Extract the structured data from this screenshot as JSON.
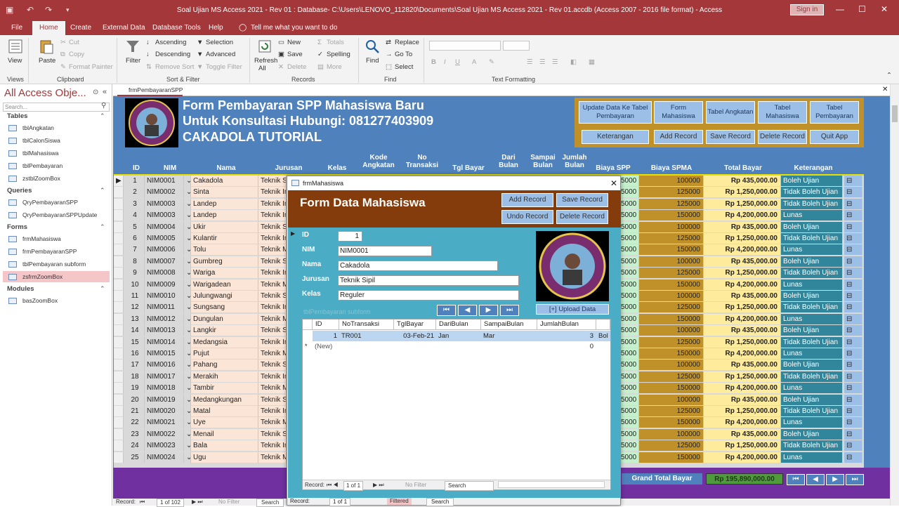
{
  "window": {
    "title": "Soal Ujian MS Access 2021 - Rev 01 : Database- C:\\Users\\LENOVO_112820\\Documents\\Soal Ujian MS Access 2021 - Rev 01.accdb (Access 2007 - 2016 file format) - Access",
    "sign_in": "Sign in"
  },
  "ribbon": {
    "tabs": [
      "File",
      "Home",
      "Create",
      "External Data",
      "Database Tools",
      "Help"
    ],
    "tell_me": "Tell me what you want to do",
    "views": {
      "view": "View",
      "group": "Views"
    },
    "clipboard": {
      "paste": "Paste",
      "cut": "Cut",
      "copy": "Copy",
      "format_painter": "Format Painter",
      "group": "Clipboard"
    },
    "sort_filter": {
      "filter": "Filter",
      "ascending": "Ascending",
      "descending": "Descending",
      "remove_sort": "Remove Sort",
      "selection": "Selection",
      "advanced": "Advanced",
      "toggle_filter": "Toggle Filter",
      "group": "Sort & Filter"
    },
    "records": {
      "refresh": "Refresh",
      "refresh_all": "All",
      "new": "New",
      "save": "Save",
      "delete": "Delete",
      "totals": "Totals",
      "spelling": "Spelling",
      "more": "More",
      "group": "Records"
    },
    "find": {
      "find": "Find",
      "replace": "Replace",
      "goto": "Go To",
      "select": "Select",
      "group": "Find"
    },
    "text_formatting": {
      "group": "Text Formatting"
    }
  },
  "nav": {
    "title": "All Access Obje...",
    "search_placeholder": "Search...",
    "sections": [
      {
        "name": "Tables",
        "items": [
          "tblAngkatan",
          "tblCalonSiswa",
          "tblMahasiswa",
          "tblPembayaran",
          "zstblZoomBox"
        ]
      },
      {
        "name": "Queries",
        "items": [
          "QryPembayaranSPP",
          "QryPembayaranSPPUpdate"
        ]
      },
      {
        "name": "Forms",
        "items": [
          "frmMahasiswa",
          "frmPembayaranSPP",
          "tblPembayaran subform",
          "zsfrmZoomBox"
        ]
      },
      {
        "name": "Modules",
        "items": [
          "basZoomBox"
        ]
      }
    ],
    "selected": "zsfrmZoomBox"
  },
  "document": {
    "tab": "frmPembayaranSPP",
    "header_lines": [
      "Form Pembayaran SPP Mahasiswa Baru",
      "Untuk Konsultasi Hubungi: 081277403909",
      "CAKADOLA TUTORIAL"
    ],
    "nav_buttons": [
      "Update Data Ke Tabel Pembayaran",
      "Form Mahasiswa",
      "Tabel Angkatan",
      "Tabel Mahasiswa",
      "Tabel Pembayaran"
    ],
    "action_buttons": [
      "Keterangan",
      "Add Record",
      "Save Record",
      "Delete Record",
      "Quit App"
    ],
    "columns": [
      "ID",
      "NIM",
      "Nama",
      "Jurusan",
      "Kelas",
      "Kode Angkatan",
      "No Transaksi",
      "Tgl Bayar",
      "Dari Bulan",
      "Sampai Bulan",
      "Jumlah Bulan",
      "Biaya SPP",
      "Biaya SPMA",
      "Total Bayar",
      "Keterangan"
    ],
    "rows": [
      {
        "id": "1",
        "nim": "NIM0001",
        "nama": "Cakadola",
        "jurusan": "Teknik S",
        "spp": "5000",
        "spma": "100000",
        "total": "Rp 435,000.00",
        "ket": "Boleh Ujian"
      },
      {
        "id": "2",
        "nim": "NIM0002",
        "nama": "Sinta",
        "jurusan": "Teknik In",
        "spp": "5000",
        "spma": "125000",
        "total": "Rp 1,250,000.00",
        "ket": "Tidak Boleh Ujian"
      },
      {
        "id": "3",
        "nim": "NIM0003",
        "nama": "Landep",
        "jurusan": "Teknik In",
        "spp": "5000",
        "spma": "125000",
        "total": "Rp 1,250,000.00",
        "ket": "Tidak Boleh Ujian"
      },
      {
        "id": "4",
        "nim": "NIM0003",
        "nama": "Landep",
        "jurusan": "Teknik In",
        "spp": "5000",
        "spma": "150000",
        "total": "Rp 4,200,000.00",
        "ket": "Lunas"
      },
      {
        "id": "5",
        "nim": "NIM0004",
        "nama": "Ukir",
        "jurusan": "Teknik S",
        "spp": "5000",
        "spma": "100000",
        "total": "Rp 435,000.00",
        "ket": "Boleh Ujian"
      },
      {
        "id": "6",
        "nim": "NIM0005",
        "nama": "Kulantir",
        "jurusan": "Teknik In",
        "spp": "5000",
        "spma": "125000",
        "total": "Rp 1,250,000.00",
        "ket": "Tidak Boleh Ujian"
      },
      {
        "id": "7",
        "nim": "NIM0006",
        "nama": "Tolu",
        "jurusan": "Teknik M",
        "spp": "5000",
        "spma": "150000",
        "total": "Rp 4,200,000.00",
        "ket": "Lunas"
      },
      {
        "id": "8",
        "nim": "NIM0007",
        "nama": "Gumbreg",
        "jurusan": "Teknik S",
        "spp": "5000",
        "spma": "100000",
        "total": "Rp 435,000.00",
        "ket": "Boleh Ujian"
      },
      {
        "id": "9",
        "nim": "NIM0008",
        "nama": "Wariga",
        "jurusan": "Teknik In",
        "spp": "5000",
        "spma": "125000",
        "total": "Rp 1,250,000.00",
        "ket": "Tidak Boleh Ujian"
      },
      {
        "id": "10",
        "nim": "NIM0009",
        "nama": "Warigadean",
        "jurusan": "Teknik M",
        "spp": "5000",
        "spma": "150000",
        "total": "Rp 4,200,000.00",
        "ket": "Lunas"
      },
      {
        "id": "11",
        "nim": "NIM0010",
        "nama": "Julungwangi",
        "jurusan": "Teknik S",
        "spp": "5000",
        "spma": "100000",
        "total": "Rp 435,000.00",
        "ket": "Boleh Ujian"
      },
      {
        "id": "12",
        "nim": "NIM0011",
        "nama": "Sungsang",
        "jurusan": "Teknik In",
        "spp": "5000",
        "spma": "125000",
        "total": "Rp 1,250,000.00",
        "ket": "Tidak Boleh Ujian"
      },
      {
        "id": "13",
        "nim": "NIM0012",
        "nama": "Dungulan",
        "jurusan": "Teknik M",
        "spp": "5000",
        "spma": "150000",
        "total": "Rp 4,200,000.00",
        "ket": "Lunas"
      },
      {
        "id": "14",
        "nim": "NIM0013",
        "nama": "Langkir",
        "jurusan": "Teknik S",
        "spp": "5000",
        "spma": "100000",
        "total": "Rp 435,000.00",
        "ket": "Boleh Ujian"
      },
      {
        "id": "15",
        "nim": "NIM0014",
        "nama": "Medangsia",
        "jurusan": "Teknik In",
        "spp": "5000",
        "spma": "125000",
        "total": "Rp 1,250,000.00",
        "ket": "Tidak Boleh Ujian"
      },
      {
        "id": "16",
        "nim": "NIM0015",
        "nama": "Pujut",
        "jurusan": "Teknik M",
        "spp": "5000",
        "spma": "150000",
        "total": "Rp 4,200,000.00",
        "ket": "Lunas"
      },
      {
        "id": "17",
        "nim": "NIM0016",
        "nama": "Pahang",
        "jurusan": "Teknik S",
        "spp": "5000",
        "spma": "100000",
        "total": "Rp 435,000.00",
        "ket": "Boleh Ujian"
      },
      {
        "id": "18",
        "nim": "NIM0017",
        "nama": "Merakih",
        "jurusan": "Teknik In",
        "spp": "5000",
        "spma": "125000",
        "total": "Rp 1,250,000.00",
        "ket": "Tidak Boleh Ujian"
      },
      {
        "id": "19",
        "nim": "NIM0018",
        "nama": "Tambir",
        "jurusan": "Teknik M",
        "spp": "5000",
        "spma": "150000",
        "total": "Rp 4,200,000.00",
        "ket": "Lunas"
      },
      {
        "id": "20",
        "nim": "NIM0019",
        "nama": "Medangkungan",
        "jurusan": "Teknik S",
        "spp": "5000",
        "spma": "100000",
        "total": "Rp 435,000.00",
        "ket": "Boleh Ujian"
      },
      {
        "id": "21",
        "nim": "NIM0020",
        "nama": "Matal",
        "jurusan": "Teknik In",
        "spp": "5000",
        "spma": "125000",
        "total": "Rp 1,250,000.00",
        "ket": "Tidak Boleh Ujian"
      },
      {
        "id": "22",
        "nim": "NIM0021",
        "nama": "Uye",
        "jurusan": "Teknik M",
        "spp": "5000",
        "spma": "150000",
        "total": "Rp 4,200,000.00",
        "ket": "Lunas"
      },
      {
        "id": "23",
        "nim": "NIM0022",
        "nama": "Menail",
        "jurusan": "Teknik S",
        "spp": "5000",
        "spma": "100000",
        "total": "Rp 435,000.00",
        "ket": "Boleh Ujian"
      },
      {
        "id": "24",
        "nim": "NIM0023",
        "nama": "Bala",
        "jurusan": "Teknik In",
        "spp": "5000",
        "spma": "125000",
        "total": "Rp 1,250,000.00",
        "ket": "Tidak Boleh Ujian"
      },
      {
        "id": "25",
        "nim": "NIM0024",
        "nama": "Ugu",
        "jurusan": "Teknik M",
        "spp": "5000",
        "spma": "150000",
        "total": "Rp 4,200,000.00",
        "ket": "Lunas"
      }
    ],
    "grand_total_label": "Grand Total Bayar",
    "grand_total_value": "Rp 195,890,000.00",
    "record_bar": {
      "label": "Record:",
      "position": "1 of 102",
      "no_filter": "No Filter",
      "search": "Search"
    }
  },
  "popup": {
    "window_title": "frmMahasiswa",
    "heading": "Form Data Mahasiswa",
    "buttons": [
      "Add Record",
      "Save Record",
      "Undo Record",
      "Delete Record"
    ],
    "fields": [
      {
        "label": "ID",
        "value": "1"
      },
      {
        "label": "NIM",
        "value": "NIM0001"
      },
      {
        "label": "Nama",
        "value": "Cakadola"
      },
      {
        "label": "Jurusan",
        "value": "Teknik Sipil"
      },
      {
        "label": "Kelas",
        "value": "Reguler"
      }
    ],
    "upload_label": "[+] Upload Data",
    "subform_label": "tblPembayaran subform",
    "sub_columns": [
      "ID",
      "NoTransaksi",
      "TglBayar",
      "DariBulan",
      "SampaiBulan",
      "JumlahBulan"
    ],
    "sub_row": {
      "id": "1",
      "no": "TR001",
      "tgl": "03-Feb-21",
      "dari": "Jan",
      "sampai": "Mar",
      "jumlah": "3",
      "extra": "Bol"
    },
    "new_row": {
      "label": "(New)",
      "value": "0"
    },
    "sub_record_bar": {
      "label": "Record:",
      "position": "1 of 1",
      "no_filter": "No Filter",
      "search": "Search"
    },
    "outer_record_bar": {
      "label": "Record:",
      "position": "1 of 1",
      "filtered": "Filtered",
      "search": "Search"
    }
  },
  "colors": {
    "access_red": "#a4373a",
    "form_blue": "#4f81bd",
    "gold": "#c09128",
    "popup_header": "#843c0c",
    "popup_body": "#4bacc6"
  }
}
